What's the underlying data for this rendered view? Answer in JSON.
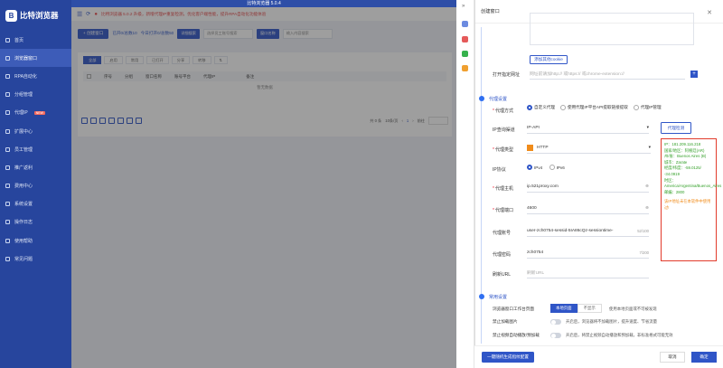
{
  "app": {
    "title": "比特浏览器",
    "window_title": "比特浏览器 5.0.4"
  },
  "sidebar": {
    "items": [
      {
        "label": "首页"
      },
      {
        "label": "浏览器窗口"
      },
      {
        "label": "RPA自动化"
      },
      {
        "label": "分组管理"
      },
      {
        "label": "代理IP",
        "badge": "NEW"
      },
      {
        "label": "扩展中心"
      },
      {
        "label": "员工管理"
      },
      {
        "label": "推广返利"
      },
      {
        "label": "费用中心"
      },
      {
        "label": "系统设置"
      },
      {
        "label": "操作日志"
      },
      {
        "label": "使用帮助"
      },
      {
        "label": "常见问题"
      }
    ]
  },
  "notice": "比特浏览器 5.0.2 升级，新增代理IP重复检测，优化客户端性能，提升RPA自动化功能体验",
  "toolbar": {
    "create": "+ 创建窗口",
    "opened": "已开0/总数10",
    "today_open": "今日打开0/总数50",
    "search_btn": "详细搜索",
    "select_placeholder": "选择员工账号搜索",
    "search_label": "窗口名称",
    "search_placeholder": "输入内容搜索"
  },
  "tabs": [
    "全部",
    "启用",
    "常用",
    "已打开",
    "分享",
    "转移"
  ],
  "table_headers": [
    "序号",
    "分组",
    "窗口名称",
    "账号平台",
    "代理IP",
    "备注"
  ],
  "empty_text": "暂无数据",
  "pager": {
    "total": "共 0 条",
    "per_page": "10条/页",
    "page": "1",
    "goto": "前往"
  },
  "drawer": {
    "title": "创建窗口",
    "add_cookie": "添加其他cookie",
    "open_url_label": "打开指定网址",
    "open_url_placeholder": "网址前请加http:// 或https:// 或chrome-extension://",
    "proxy_section": "代理设置",
    "proxy_mode_label": "代理方式",
    "proxy_modes": [
      "自定义代理",
      "使用代理IP平台API提取链接提取",
      "代理IP管理"
    ],
    "ip_query_label": "IP查询渠道",
    "ip_query_value": "IP-API",
    "proxy_check_btn": "代理检测",
    "proxy_type_label": "代理类型",
    "proxy_type_value": "HTTP",
    "ip_protocol_label": "IP协议",
    "ip_protocols": [
      "IPv4",
      "IPv6"
    ],
    "host_label": "代理主机",
    "host_value": "ip.521proxy.com",
    "port_label": "代理端口",
    "port_value": "4600",
    "account_label": "代理账号",
    "account_value": "user-zch0754-sessid-5IA86cQz-sessiontime-",
    "account_count": "52/100",
    "password_label": "代理密码",
    "password_value": "zch0754",
    "password_count": "7/200",
    "refresh_label": "刷新URL",
    "refresh_placeholder": "刷新URL",
    "common_section": "常用设置",
    "workbench_label": "浏览器窗口工作台页面",
    "workbench_opts": [
      "本地页面",
      "不显示"
    ],
    "workbench_hint": "使用本地页面或不可被发现",
    "block_img_label": "禁止加载图片",
    "block_img_hint": "开启后，浏览器将不加载图片，提升速度、节省流量",
    "block_video_label": "禁止视频自动播放/预加载",
    "block_video_hint": "开启后，将禁止视频自动播放和预加载，非标准格式可能无效",
    "gen_btn": "一键随机生成指纹配置",
    "cancel": "取消",
    "ok": "确定"
  },
  "proxy_info": {
    "ip": "IP：181.209.116.218",
    "country": "国家/地区：阿根廷(AR)",
    "state": "州/省：Buenos Aires (B)",
    "city": "城市：Zarate",
    "coords": "经度/纬度：-59.0125/ -34.0919",
    "tz": "时区：America/Argentina/Buenos_Aires",
    "zip": "邮编：2800",
    "warn": "该IP地址未在本软件中使用过!"
  },
  "colors": {
    "accent": "#2f55c7",
    "sidebar": "#27459d",
    "warn": "#e23b2b",
    "ok": "#35a12a"
  }
}
